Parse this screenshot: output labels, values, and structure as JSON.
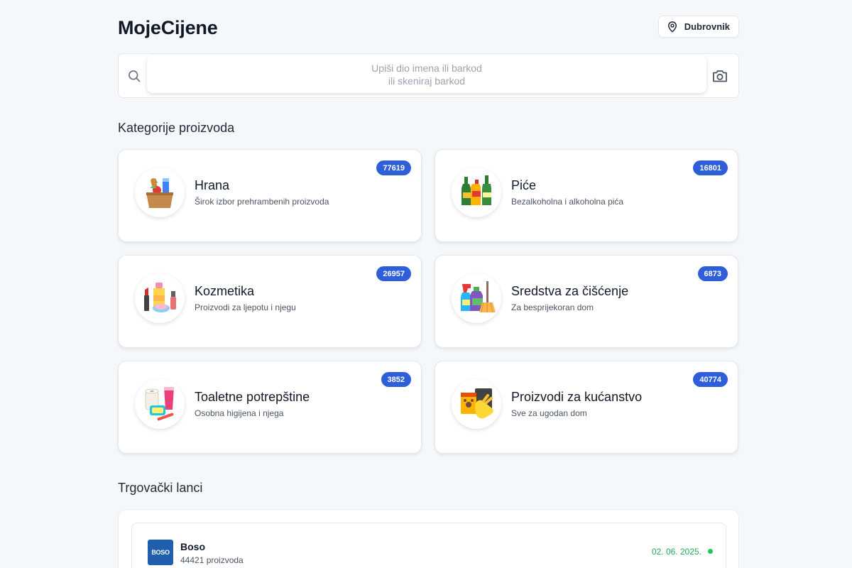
{
  "header": {
    "title": "MojeCijene",
    "location_label": "Dubrovnik"
  },
  "search": {
    "placeholder": "Upiši dio imena ili barkod\nili skeniraj barkod"
  },
  "sections": {
    "categories_title": "Kategorije proizvoda",
    "chains_title": "Trgovački lanci"
  },
  "categories": [
    {
      "name": "Hrana",
      "description": "Širok izbor prehrambenih proizvoda",
      "count": "77619",
      "icon": "grocery-bag-icon"
    },
    {
      "name": "Piće",
      "description": "Bezalkoholna i alkoholna pića",
      "count": "16801",
      "icon": "bottles-icon"
    },
    {
      "name": "Kozmetika",
      "description": "Proizvodi za ljepotu i njegu",
      "count": "26957",
      "icon": "cosmetics-icon"
    },
    {
      "name": "Sredstva za čišćenje",
      "description": "Za besprijekoran dom",
      "count": "6873",
      "icon": "cleaning-supplies-icon"
    },
    {
      "name": "Toaletne potrepštine",
      "description": "Osobna higijena i njega",
      "count": "3852",
      "icon": "toiletries-icon"
    },
    {
      "name": "Proizvodi za kućanstvo",
      "description": "Sve za ugodan dom",
      "count": "40774",
      "icon": "household-icon"
    }
  ],
  "chains": [
    {
      "name": "Boso",
      "logo_text": "BOSO",
      "product_count": "44421 proizvoda",
      "date": "02. 06. 2025.",
      "status_color": "#22c55e"
    }
  ],
  "colors": {
    "accent": "#2f5fd8",
    "background": "#f5f8fb",
    "status_ok": "#22c55e"
  }
}
